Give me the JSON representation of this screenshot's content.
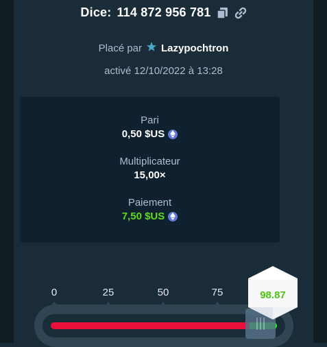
{
  "bet": {
    "game_label": "Dice:",
    "id": "114 872 956 781",
    "placed_by_prefix": "Placé par",
    "username": "Lazypochtron",
    "activated": "activé 12/10/2022 à 13:28"
  },
  "summary": {
    "bet_label": "Pari",
    "bet_value": "0,50 $US",
    "multiplier_label": "Multiplicateur",
    "multiplier_value": "15,00×",
    "payout_label": "Paiement",
    "payout_value": "7,50 $US"
  },
  "slider": {
    "ticks": [
      "0",
      "25",
      "50",
      "75"
    ],
    "threshold": 93.4,
    "result": "98.87"
  },
  "colors": {
    "payout_green": "#5ddb1c",
    "lose_red": "#e9113c",
    "win_green": "#1fff20",
    "currency_blue": "#6176d8"
  },
  "icons": {
    "copy": "copy-icon",
    "link": "link-icon",
    "star": "star-icon",
    "currency": "ethereum-icon"
  }
}
